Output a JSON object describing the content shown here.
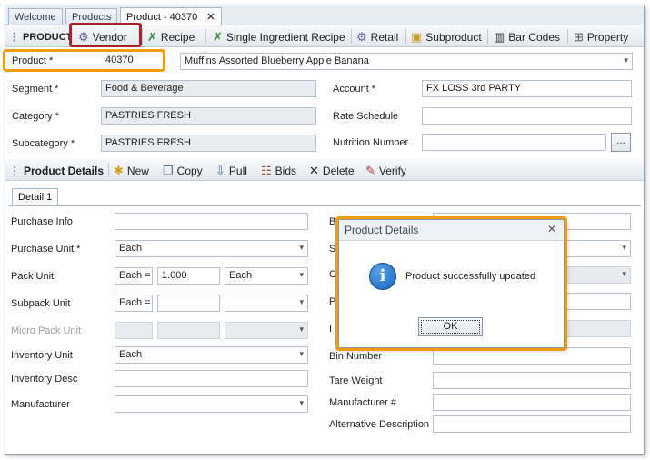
{
  "tabs": [
    {
      "label": "Welcome"
    },
    {
      "label": "Products"
    },
    {
      "label": "Product - 40370"
    }
  ],
  "tab_close": "✕",
  "toolbar1": {
    "section_label": "PRODUCT",
    "vendor": "Vendor",
    "recipe": "Recipe",
    "single_ingredient_recipe": "Single Ingredient Recipe",
    "retail": "Retail",
    "subproduct": "Subproduct",
    "bar_codes": "Bar Codes",
    "property": "Property"
  },
  "product": {
    "label": "Product *",
    "code": "40370",
    "description": "Muffins Assorted Blueberry Apple  Banana"
  },
  "header_fields": {
    "segment_label": "Segment *",
    "segment_value": "Food & Beverage",
    "category_label": "Category *",
    "category_value": "PASTRIES FRESH",
    "subcategory_label": "Subcategory *",
    "subcategory_value": "PASTRIES FRESH",
    "account_label": "Account *",
    "account_value": "FX LOSS 3rd PARTY",
    "rate_schedule_label": "Rate Schedule",
    "rate_schedule_value": "",
    "nutrition_number_label": "Nutrition Number",
    "nutrition_number_value": "",
    "browse_label": "..."
  },
  "toolbar2": {
    "section_label": "Product Details",
    "new": "New",
    "copy": "Copy",
    "pull": "Pull",
    "bids": "Bids",
    "delete": "Delete",
    "verify": "Verify"
  },
  "detail_tab": "Detail 1",
  "left_form": {
    "purchase_info_label": "Purchase Info",
    "purchase_info_value": "",
    "purchase_unit_label": "Purchase Unit *",
    "purchase_unit_value": "Each",
    "pack_unit_label": "Pack Unit",
    "pack_each_eq": "Each =",
    "pack_qty": "1.000",
    "pack_unit_value": "Each",
    "subpack_unit_label": "Subpack Unit",
    "subpack_each_eq": "Each =",
    "micro_pack_unit_label": "Micro Pack Unit",
    "inventory_unit_label": "Inventory Unit",
    "inventory_unit_value": "Each",
    "inventory_desc_label": "Inventory Desc",
    "manufacturer_label": "Manufacturer"
  },
  "right_form": {
    "row1_label_fragment": "B",
    "row2_label_fragment": "S",
    "row3_label_fragment": "C",
    "row4_label_fragment": "P",
    "row5_label_fragment": "I",
    "bin_number_label": "Bin Number",
    "tare_weight_label": "Tare Weight",
    "manufacturer_no_label": "Manufacturer #",
    "alternative_description_label": "Alternative Description"
  },
  "dialog": {
    "title": "Product Details",
    "close": "✕",
    "icon_glyph": "i",
    "message": "Product successfully updated",
    "ok": "OK"
  },
  "colors": {
    "highlight_orange": "#f39c12",
    "highlight_red": "#b0202b",
    "info_icon_blue": "#1565c0"
  }
}
